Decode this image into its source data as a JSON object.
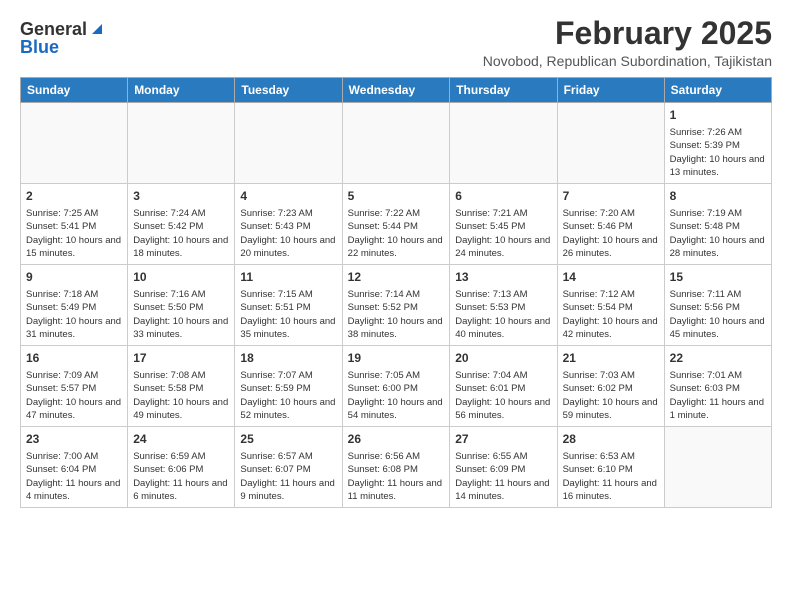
{
  "header": {
    "logo_general": "General",
    "logo_blue": "Blue",
    "month": "February 2025",
    "location": "Novobod, Republican Subordination, Tajikistan"
  },
  "weekdays": [
    "Sunday",
    "Monday",
    "Tuesday",
    "Wednesday",
    "Thursday",
    "Friday",
    "Saturday"
  ],
  "weeks": [
    [
      {
        "day": "",
        "info": ""
      },
      {
        "day": "",
        "info": ""
      },
      {
        "day": "",
        "info": ""
      },
      {
        "day": "",
        "info": ""
      },
      {
        "day": "",
        "info": ""
      },
      {
        "day": "",
        "info": ""
      },
      {
        "day": "1",
        "info": "Sunrise: 7:26 AM\nSunset: 5:39 PM\nDaylight: 10 hours and 13 minutes."
      }
    ],
    [
      {
        "day": "2",
        "info": "Sunrise: 7:25 AM\nSunset: 5:41 PM\nDaylight: 10 hours and 15 minutes."
      },
      {
        "day": "3",
        "info": "Sunrise: 7:24 AM\nSunset: 5:42 PM\nDaylight: 10 hours and 18 minutes."
      },
      {
        "day": "4",
        "info": "Sunrise: 7:23 AM\nSunset: 5:43 PM\nDaylight: 10 hours and 20 minutes."
      },
      {
        "day": "5",
        "info": "Sunrise: 7:22 AM\nSunset: 5:44 PM\nDaylight: 10 hours and 22 minutes."
      },
      {
        "day": "6",
        "info": "Sunrise: 7:21 AM\nSunset: 5:45 PM\nDaylight: 10 hours and 24 minutes."
      },
      {
        "day": "7",
        "info": "Sunrise: 7:20 AM\nSunset: 5:46 PM\nDaylight: 10 hours and 26 minutes."
      },
      {
        "day": "8",
        "info": "Sunrise: 7:19 AM\nSunset: 5:48 PM\nDaylight: 10 hours and 28 minutes."
      }
    ],
    [
      {
        "day": "9",
        "info": "Sunrise: 7:18 AM\nSunset: 5:49 PM\nDaylight: 10 hours and 31 minutes."
      },
      {
        "day": "10",
        "info": "Sunrise: 7:16 AM\nSunset: 5:50 PM\nDaylight: 10 hours and 33 minutes."
      },
      {
        "day": "11",
        "info": "Sunrise: 7:15 AM\nSunset: 5:51 PM\nDaylight: 10 hours and 35 minutes."
      },
      {
        "day": "12",
        "info": "Sunrise: 7:14 AM\nSunset: 5:52 PM\nDaylight: 10 hours and 38 minutes."
      },
      {
        "day": "13",
        "info": "Sunrise: 7:13 AM\nSunset: 5:53 PM\nDaylight: 10 hours and 40 minutes."
      },
      {
        "day": "14",
        "info": "Sunrise: 7:12 AM\nSunset: 5:54 PM\nDaylight: 10 hours and 42 minutes."
      },
      {
        "day": "15",
        "info": "Sunrise: 7:11 AM\nSunset: 5:56 PM\nDaylight: 10 hours and 45 minutes."
      }
    ],
    [
      {
        "day": "16",
        "info": "Sunrise: 7:09 AM\nSunset: 5:57 PM\nDaylight: 10 hours and 47 minutes."
      },
      {
        "day": "17",
        "info": "Sunrise: 7:08 AM\nSunset: 5:58 PM\nDaylight: 10 hours and 49 minutes."
      },
      {
        "day": "18",
        "info": "Sunrise: 7:07 AM\nSunset: 5:59 PM\nDaylight: 10 hours and 52 minutes."
      },
      {
        "day": "19",
        "info": "Sunrise: 7:05 AM\nSunset: 6:00 PM\nDaylight: 10 hours and 54 minutes."
      },
      {
        "day": "20",
        "info": "Sunrise: 7:04 AM\nSunset: 6:01 PM\nDaylight: 10 hours and 56 minutes."
      },
      {
        "day": "21",
        "info": "Sunrise: 7:03 AM\nSunset: 6:02 PM\nDaylight: 10 hours and 59 minutes."
      },
      {
        "day": "22",
        "info": "Sunrise: 7:01 AM\nSunset: 6:03 PM\nDaylight: 11 hours and 1 minute."
      }
    ],
    [
      {
        "day": "23",
        "info": "Sunrise: 7:00 AM\nSunset: 6:04 PM\nDaylight: 11 hours and 4 minutes."
      },
      {
        "day": "24",
        "info": "Sunrise: 6:59 AM\nSunset: 6:06 PM\nDaylight: 11 hours and 6 minutes."
      },
      {
        "day": "25",
        "info": "Sunrise: 6:57 AM\nSunset: 6:07 PM\nDaylight: 11 hours and 9 minutes."
      },
      {
        "day": "26",
        "info": "Sunrise: 6:56 AM\nSunset: 6:08 PM\nDaylight: 11 hours and 11 minutes."
      },
      {
        "day": "27",
        "info": "Sunrise: 6:55 AM\nSunset: 6:09 PM\nDaylight: 11 hours and 14 minutes."
      },
      {
        "day": "28",
        "info": "Sunrise: 6:53 AM\nSunset: 6:10 PM\nDaylight: 11 hours and 16 minutes."
      },
      {
        "day": "",
        "info": ""
      }
    ]
  ]
}
